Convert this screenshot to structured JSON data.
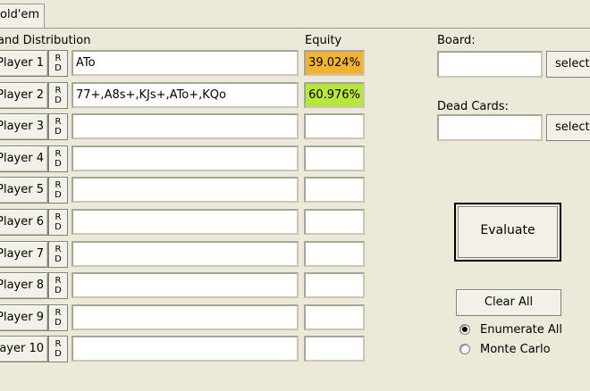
{
  "tabs": [
    {
      "label": "old'em"
    }
  ],
  "labels": {
    "hand_distribution": "and Distribution",
    "equity": "Equity",
    "board": "Board:",
    "dead_cards": "Dead Cards:"
  },
  "rd_label": {
    "r": "R",
    "d": "D"
  },
  "players": [
    {
      "label": "Player 1",
      "hand": "ATo",
      "equity": "39.024%",
      "equity_color": "#f2b233"
    },
    {
      "label": "Player 2",
      "hand": "77+,A8s+,KJs+,ATo+,KQo",
      "equity": "60.976%",
      "equity_color": "#b8e63c"
    },
    {
      "label": "Player 3",
      "hand": "",
      "equity": "",
      "equity_color": "#ffffff"
    },
    {
      "label": "Player 4",
      "hand": "",
      "equity": "",
      "equity_color": "#ffffff"
    },
    {
      "label": "Player 5",
      "hand": "",
      "equity": "",
      "equity_color": "#ffffff"
    },
    {
      "label": "Player 6",
      "hand": "",
      "equity": "",
      "equity_color": "#ffffff"
    },
    {
      "label": "Player 7",
      "hand": "",
      "equity": "",
      "equity_color": "#ffffff"
    },
    {
      "label": "Player 8",
      "hand": "",
      "equity": "",
      "equity_color": "#ffffff"
    },
    {
      "label": "Player 9",
      "hand": "",
      "equity": "",
      "equity_color": "#ffffff"
    },
    {
      "label": "layer 10",
      "hand": "",
      "equity": "",
      "equity_color": "#ffffff"
    }
  ],
  "board": {
    "value": "",
    "select_label": "select"
  },
  "dead_cards": {
    "value": "",
    "select_label": "select"
  },
  "buttons": {
    "evaluate": "Evaluate",
    "clear_all": "Clear All"
  },
  "mode": {
    "options": [
      "Enumerate All",
      "Monte Carlo"
    ],
    "selected": "Enumerate All"
  }
}
